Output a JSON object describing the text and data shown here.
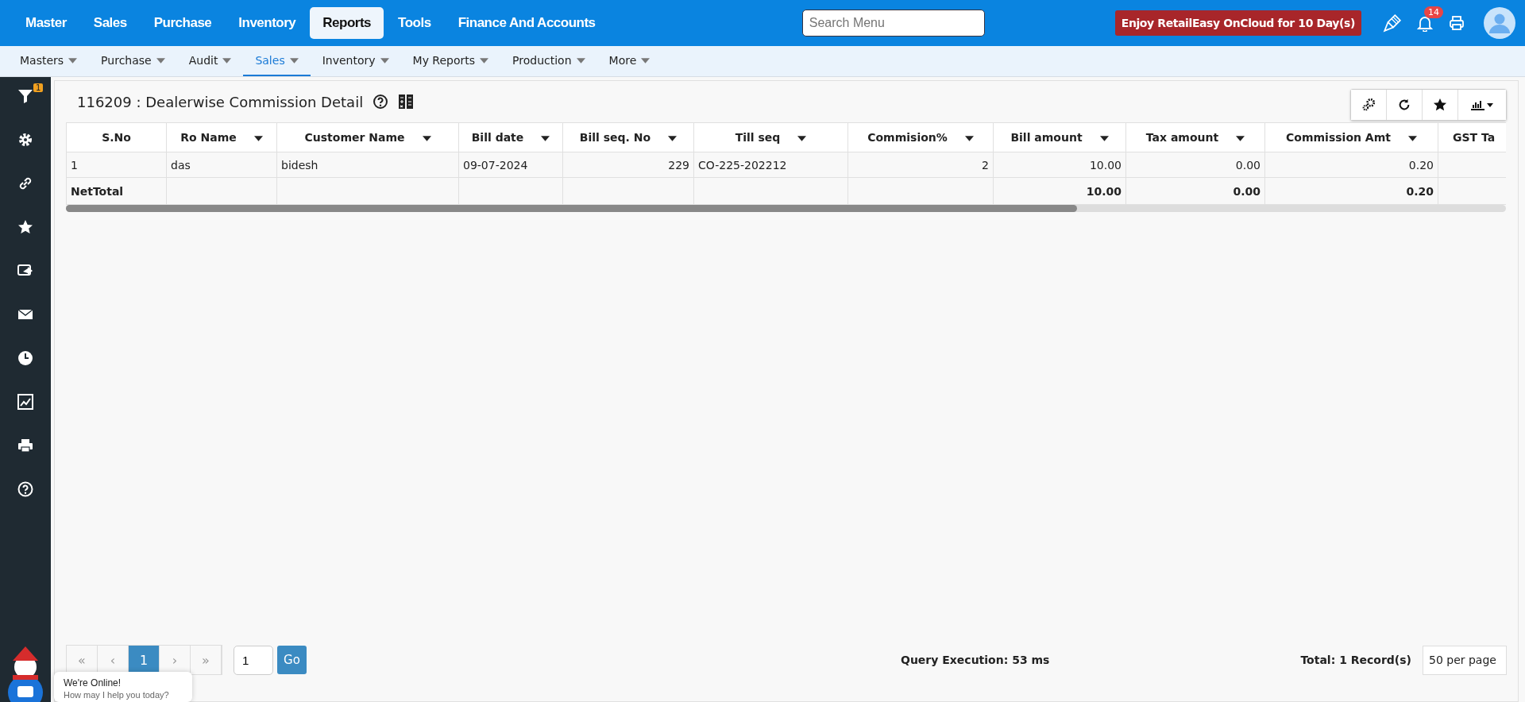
{
  "top_menu": [
    {
      "label": "Master",
      "selected": false
    },
    {
      "label": "Sales",
      "selected": false
    },
    {
      "label": "Purchase",
      "selected": false
    },
    {
      "label": "Inventory",
      "selected": false
    },
    {
      "label": "Reports",
      "selected": true
    },
    {
      "label": "Tools",
      "selected": false
    },
    {
      "label": "Finance And Accounts",
      "selected": false
    }
  ],
  "search": {
    "placeholder": "Search Menu"
  },
  "promo": "Enjoy RetailEasy OnCloud for 10 Day(s)",
  "notifications": {
    "count": "14"
  },
  "sub_menu": [
    {
      "label": "Masters",
      "selected": false
    },
    {
      "label": "Purchase",
      "selected": false
    },
    {
      "label": "Audit",
      "selected": false
    },
    {
      "label": "Sales",
      "selected": true
    },
    {
      "label": "Inventory",
      "selected": false
    },
    {
      "label": "My Reports",
      "selected": false
    },
    {
      "label": "Production",
      "selected": false
    },
    {
      "label": "More",
      "selected": false
    }
  ],
  "sidebar": {
    "filter_badge": "1",
    "items": [
      {
        "kind": "filter"
      },
      {
        "kind": "gear"
      },
      {
        "kind": "link"
      },
      {
        "kind": "star"
      },
      {
        "kind": "share"
      },
      {
        "kind": "mail"
      },
      {
        "kind": "clock"
      },
      {
        "kind": "chart"
      },
      {
        "kind": "print"
      },
      {
        "kind": "help"
      }
    ]
  },
  "report": {
    "title": "116209 : Dealerwise Commission Detail",
    "table": {
      "columns": [
        {
          "label": "S.No",
          "filter": false
        },
        {
          "label": "Ro Name",
          "filter": true
        },
        {
          "label": "Customer Name",
          "filter": true
        },
        {
          "label": "Bill date",
          "filter": true
        },
        {
          "label": "Bill seq. No",
          "filter": true
        },
        {
          "label": "Till seq",
          "filter": true
        },
        {
          "label": "Commision%",
          "filter": true
        },
        {
          "label": "Bill amount",
          "filter": true
        },
        {
          "label": "Tax amount",
          "filter": true
        },
        {
          "label": "Commission Amt",
          "filter": true
        },
        {
          "label": "GST Ta",
          "filter": false
        }
      ],
      "rows": [
        {
          "s_no": "1",
          "ro_name": "das",
          "customer_name": "bidesh",
          "bill_date": "09-07-2024",
          "bill_seq_no": "229",
          "till_seq": "CO-225-202212",
          "commission_pct": "2",
          "bill_amount": "10.00",
          "tax_amount": "0.00",
          "commission_amt": "0.20"
        }
      ],
      "total": {
        "label": "NetTotal",
        "bill_amount": "10.00",
        "tax_amount": "0.00",
        "commission_amt": "0.20"
      }
    }
  },
  "pager": {
    "pages": [
      {
        "label": "«",
        "selected": false
      },
      {
        "label": "‹",
        "selected": false
      },
      {
        "label": "1",
        "selected": true
      },
      {
        "label": "›",
        "selected": false
      },
      {
        "label": "»",
        "selected": false
      }
    ],
    "goto": "1",
    "go": "Go"
  },
  "query_execution": "Query Execution: 53 ms",
  "total_records": "Total: 1 Record(s)",
  "per_page": "50 per page",
  "chat": {
    "title": "We're Online!",
    "subtitle": "How may I help you today?"
  }
}
